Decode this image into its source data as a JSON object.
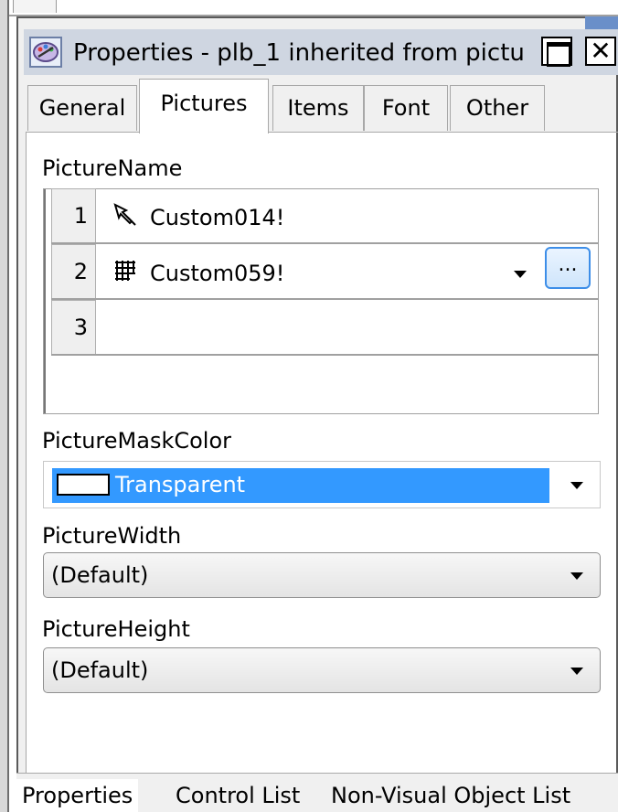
{
  "window": {
    "title": "Properties - plb_1 inherited  from  pictu",
    "restore_label": "",
    "close_label": "✕"
  },
  "tabs": [
    {
      "label": "General"
    },
    {
      "label": "Pictures"
    },
    {
      "label": "Items"
    },
    {
      "label": "Font"
    },
    {
      "label": "Other"
    }
  ],
  "active_tab": "Pictures",
  "picture_name": {
    "label": "PictureName",
    "rows": [
      {
        "num": "1",
        "icon": "pointer-icon",
        "value": "Custom014!"
      },
      {
        "num": "2",
        "icon": "grid-pattern-icon",
        "value": "Custom059!"
      },
      {
        "num": "3",
        "icon": "",
        "value": ""
      }
    ],
    "ellipsis_label": "..."
  },
  "picture_mask_color": {
    "label": "PictureMaskColor",
    "value": "Transparent",
    "swatch_color": "#ffffff",
    "selection_color": "#3399ff"
  },
  "picture_width": {
    "label": "PictureWidth",
    "value": "(Default)"
  },
  "picture_height": {
    "label": "PictureHeight",
    "value": "(Default)"
  },
  "bottom_tabs": [
    {
      "label": "Properties"
    },
    {
      "label": "Control List"
    },
    {
      "label": "Non-Visual Object List"
    }
  ]
}
